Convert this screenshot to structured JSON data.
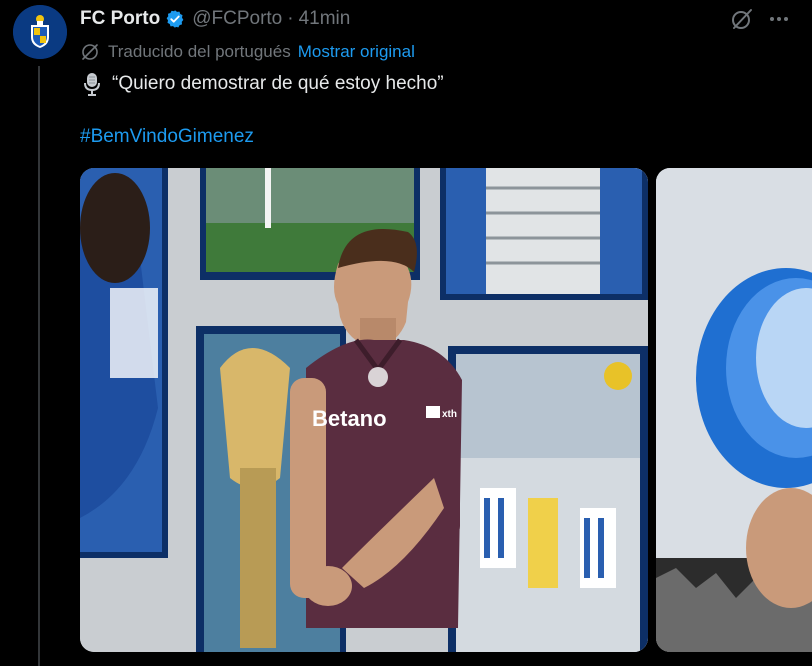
{
  "tweet": {
    "author": {
      "name": "FC Porto",
      "handle": "@FCPorto",
      "verified": true
    },
    "separator": "·",
    "time": "41min",
    "translation": {
      "label": "Traducido del portugués",
      "link": "Mostrar original"
    },
    "text": "“Quiero demostrar de qué estoy hecho”",
    "hashtag": "#BemVindoGimenez",
    "media": {
      "photo1": {
        "shirt_sponsor": "Betano",
        "sleeve_text": "xth"
      },
      "photo2": {}
    },
    "icons": {
      "verified": "verified-badge-icon",
      "grok": "grok-icon",
      "more": "more-icon",
      "translate": "globe-slash-icon",
      "quote": "microphone-icon"
    },
    "colors": {
      "link": "#1d9bf0",
      "secondary": "#71767b",
      "text": "#e7e9ea",
      "shirt": "#5a2d40",
      "club_blue": "#0a3a82"
    }
  }
}
